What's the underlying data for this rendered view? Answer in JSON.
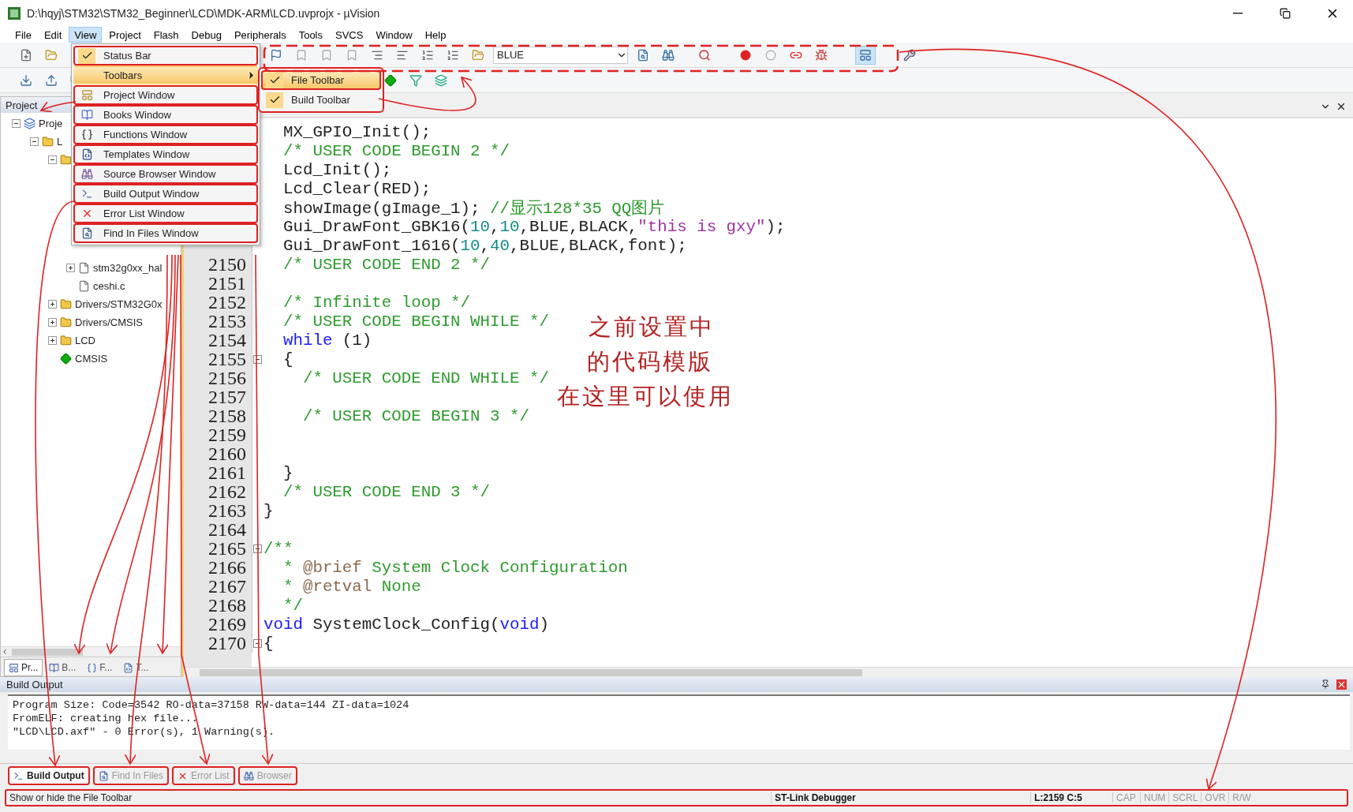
{
  "window": {
    "title": "D:\\hqyj\\STM32\\STM32_Beginner\\LCD\\MDK-ARM\\LCD.uvprojx - µVision"
  },
  "menu_bar": [
    {
      "label": "File",
      "selected": false
    },
    {
      "label": "Edit",
      "selected": false
    },
    {
      "label": "View",
      "selected": true
    },
    {
      "label": "Project",
      "selected": false
    },
    {
      "label": "Flash",
      "selected": false
    },
    {
      "label": "Debug",
      "selected": false
    },
    {
      "label": "Peripherals",
      "selected": false
    },
    {
      "label": "Tools",
      "selected": false
    },
    {
      "label": "SVCS",
      "selected": false
    },
    {
      "label": "Window",
      "selected": false
    },
    {
      "label": "Help",
      "selected": false
    }
  ],
  "view_menu": {
    "items": [
      {
        "label": "Status Bar",
        "kind": "check",
        "checked": true,
        "highlighted": false,
        "circled": true
      },
      {
        "label": "Toolbars",
        "kind": "submenu",
        "highlighted": true,
        "circled": false
      },
      {
        "label": "Project Window",
        "kind": "window",
        "highlighted": false,
        "circled": true
      },
      {
        "label": "Books Window",
        "kind": "window",
        "highlighted": false,
        "circled": true
      },
      {
        "label": "Functions Window",
        "kind": "window",
        "highlighted": false,
        "circled": true
      },
      {
        "label": "Templates Window",
        "kind": "window",
        "highlighted": false,
        "circled": true
      },
      {
        "label": "Source Browser Window",
        "kind": "window",
        "highlighted": false,
        "circled": true
      },
      {
        "label": "Build Output Window",
        "kind": "window",
        "highlighted": false,
        "circled": true
      },
      {
        "label": "Error List Window",
        "kind": "window",
        "highlighted": false,
        "circled": true
      },
      {
        "label": "Find In Files Window",
        "kind": "window",
        "highlighted": false,
        "circled": true
      }
    ],
    "submenu": {
      "circled": true,
      "items": [
        {
          "label": "File Toolbar",
          "checked": true,
          "highlighted": true,
          "circled": true
        },
        {
          "label": "Build Toolbar",
          "checked": true,
          "highlighted": false,
          "circled": false
        }
      ]
    }
  },
  "toolbar": {
    "target_combo": {
      "value": "BLUE"
    }
  },
  "project_panel": {
    "title": "Project",
    "tree": [
      {
        "label": "Proje",
        "kind": "project",
        "expanded": true,
        "children": [
          {
            "label": "L",
            "kind": "folder",
            "expanded": true,
            "children": [
              {
                "kind": "folder",
                "expanded": true,
                "children": [
                  {
                    "label": "stm32g0xx_hal",
                    "kind": "file",
                    "expandable": true
                  },
                  {
                    "label": "ceshi.c",
                    "kind": "file",
                    "expandable": false
                  }
                ]
              },
              {
                "label": "Drivers/STM32G0x",
                "kind": "folder",
                "expanded": false
              },
              {
                "label": "Drivers/CMSIS",
                "kind": "folder",
                "expanded": false
              },
              {
                "label": "LCD",
                "kind": "folder",
                "expanded": false
              },
              {
                "label": "CMSIS",
                "kind": "component"
              }
            ]
          }
        ]
      }
    ],
    "tabs": [
      {
        "label": "Pr...",
        "selected": true
      },
      {
        "label": "B...",
        "selected": false
      },
      {
        "label": "F...",
        "selected": false
      },
      {
        "label": "T...",
        "selected": false
      }
    ]
  },
  "editor": {
    "lines": [
      {
        "segments": [
          {
            "kind": "plain",
            "text": "  MX_GPIO_Init();"
          }
        ]
      },
      {
        "segments": [
          {
            "kind": "comment",
            "text": "  /* USER CODE BEGIN 2 */"
          }
        ]
      },
      {
        "segments": [
          {
            "kind": "plain",
            "text": "  Lcd_Init();"
          }
        ]
      },
      {
        "segments": [
          {
            "kind": "plain",
            "text": "  Lcd_Clear(RED);"
          }
        ]
      },
      {
        "segments": [
          {
            "kind": "plain",
            "text": "  showImage(gImage_1); "
          },
          {
            "kind": "comment",
            "text": "//显示128*35 QQ图片"
          }
        ]
      },
      {
        "segments": [
          {
            "kind": "plain",
            "text": "  Gui_DrawFont_GBK16("
          },
          {
            "kind": "number",
            "text": "10"
          },
          {
            "kind": "plain",
            "text": ","
          },
          {
            "kind": "number",
            "text": "10"
          },
          {
            "kind": "plain",
            "text": ",BLUE,BLACK,"
          },
          {
            "kind": "string",
            "text": "\"this is gxy\""
          },
          {
            "kind": "plain",
            "text": ");"
          }
        ]
      },
      {
        "segments": [
          {
            "kind": "plain",
            "text": "  Gui_DrawFont_1616("
          },
          {
            "kind": "number",
            "text": "10"
          },
          {
            "kind": "plain",
            "text": ","
          },
          {
            "kind": "number",
            "text": "40"
          },
          {
            "kind": "plain",
            "text": ",BLUE,BLACK,font);"
          }
        ]
      },
      {
        "number": "2150",
        "fold": false,
        "segments": [
          {
            "kind": "comment",
            "text": "  /* USER CODE END 2 */"
          }
        ]
      },
      {
        "number": "2151",
        "fold": false
      },
      {
        "number": "2152",
        "fold": false,
        "segments": [
          {
            "kind": "comment",
            "text": "  /* Infinite loop */"
          }
        ]
      },
      {
        "number": "2153",
        "fold": false,
        "segments": [
          {
            "kind": "comment",
            "text": "  /* USER CODE BEGIN WHILE */"
          }
        ]
      },
      {
        "number": "2154",
        "fold": false,
        "segments": [
          {
            "kind": "keyword",
            "text": "  while"
          },
          {
            "kind": "plain",
            "text": " (1)"
          }
        ]
      },
      {
        "number": "2155",
        "fold": true,
        "segments": [
          {
            "kind": "plain",
            "text": "  {"
          }
        ]
      },
      {
        "number": "2156",
        "fold": false,
        "segments": [
          {
            "kind": "comment",
            "text": "    /* USER CODE END WHILE */"
          }
        ]
      },
      {
        "number": "2157",
        "fold": false
      },
      {
        "number": "2158",
        "fold": false,
        "segments": [
          {
            "kind": "comment",
            "text": "    /* USER CODE BEGIN 3 */"
          }
        ]
      },
      {
        "number": "2159",
        "fold": false
      },
      {
        "number": "2160",
        "fold": false
      },
      {
        "number": "2161",
        "fold": false,
        "segments": [
          {
            "kind": "plain",
            "text": "  }"
          }
        ]
      },
      {
        "number": "2162",
        "fold": false,
        "segments": [
          {
            "kind": "comment",
            "text": "  /* USER CODE END 3 */"
          }
        ]
      },
      {
        "number": "2163",
        "fold": false,
        "segments": [
          {
            "kind": "plain",
            "text": "}"
          }
        ]
      },
      {
        "number": "2164",
        "fold": false
      },
      {
        "number": "2165",
        "fold": true,
        "segments": [
          {
            "kind": "comment",
            "text": "/**"
          }
        ]
      },
      {
        "number": "2166",
        "fold": false,
        "segments": [
          {
            "kind": "comment",
            "text": "  * "
          },
          {
            "kind": "doctag",
            "text": "@brief"
          },
          {
            "kind": "comment",
            "text": " System Clock Configuration"
          }
        ]
      },
      {
        "number": "2167",
        "fold": false,
        "segments": [
          {
            "kind": "comment",
            "text": "  * "
          },
          {
            "kind": "doctag",
            "text": "@retval"
          },
          {
            "kind": "comment",
            "text": " None"
          }
        ]
      },
      {
        "number": "2168",
        "fold": false,
        "segments": [
          {
            "kind": "comment",
            "text": "  */"
          }
        ]
      },
      {
        "number": "2169",
        "fold": false,
        "segments": [
          {
            "kind": "keyword",
            "text": "void"
          },
          {
            "kind": "plain",
            "text": " SystemClock_Config("
          },
          {
            "kind": "keyword",
            "text": "void"
          },
          {
            "kind": "plain",
            "text": ")"
          }
        ]
      },
      {
        "number": "2170",
        "fold": true,
        "segments": [
          {
            "kind": "plain",
            "text": "{"
          }
        ]
      }
    ]
  },
  "build_output": {
    "title": "Build Output",
    "lines": [
      "Program Size: Code=3542 RO-data=37158 RW-data=144 ZI-data=1024",
      "FromELF: creating hex file...",
      "\"LCD\\LCD.axf\" - 0 Error(s), 1 Warning(s)."
    ],
    "tabs": [
      {
        "label": "Build Output",
        "selected": true,
        "circled": true
      },
      {
        "label": "Find In Files",
        "selected": false,
        "circled": true
      },
      {
        "label": "Error List",
        "selected": false,
        "circled": true
      },
      {
        "label": "Browser",
        "selected": false,
        "circled": true
      }
    ]
  },
  "status_bar": {
    "circled": true,
    "message": "Show or hide the File Toolbar",
    "segments": [
      {
        "text": "ST-Link Debugger",
        "enabled": true
      },
      {
        "text": "L:2159 C:5",
        "enabled": true
      },
      {
        "text": "CAP",
        "enabled": false
      },
      {
        "text": "NUM",
        "enabled": false
      },
      {
        "text": "SCRL",
        "enabled": false
      },
      {
        "text": "OVR",
        "enabled": false
      },
      {
        "text": "R/W",
        "enabled": false
      }
    ]
  },
  "annotation": {
    "lines": [
      "之前设置中",
      "的代码模版",
      "在这里可以使用"
    ]
  }
}
